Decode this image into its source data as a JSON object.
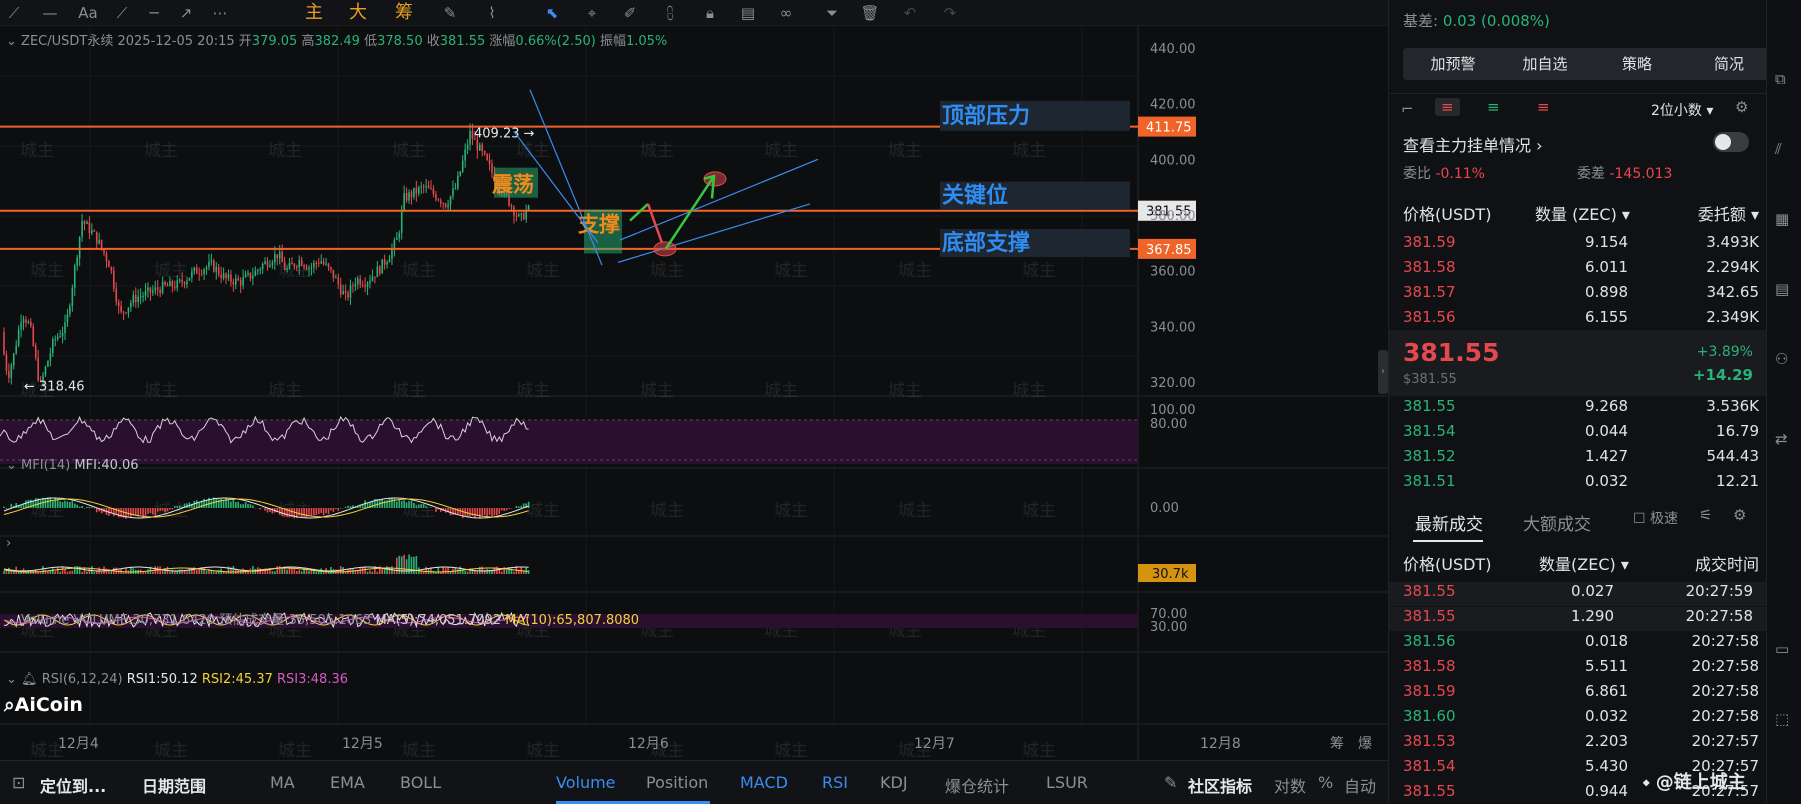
{
  "toolbar": {
    "items": [
      "主",
      "大",
      "筹"
    ]
  },
  "header": {
    "symbol": "ZEC/USDT永续",
    "datetime": "2025-12-05 20:15",
    "open_label": "开",
    "open": "379.05",
    "high_label": "高",
    "high": "382.49",
    "low_label": "低",
    "low": "378.50",
    "close_label": "收",
    "close": "381.55",
    "change_label": "涨幅",
    "change": "0.66%(2.50)",
    "amp_label": "振幅",
    "amp": "1.05%"
  },
  "price_axis": {
    "ticks": [
      "440.00",
      "420.00",
      "400.00",
      "380.00",
      "360.00",
      "340.00",
      "320.00"
    ]
  },
  "levels": [
    {
      "price": "411.75",
      "color": "#f0642a"
    },
    {
      "price": "381.55",
      "color": "#f0642a"
    },
    {
      "price": "367.85",
      "color": "#f0642a"
    }
  ],
  "annotations": {
    "top": "顶部压力",
    "key": "关键位",
    "bottom": "底部支撑",
    "oscillation": "震荡",
    "support": "支撑",
    "high_marker": "409.23 →",
    "low_marker": "← 318.46"
  },
  "indicators": {
    "mfi": {
      "label": "MFI(14)",
      "value": "MFI:40.06",
      "ticks": [
        "100.00",
        "80.00"
      ]
    },
    "macd": {
      "tick": "0.00"
    },
    "volume": {
      "label": "Volume",
      "value": "VOLUME:30,731.6420",
      "est": "预估成交量:35,505.1063",
      "ma5": "MA(5):74,051.7092",
      "ma10": "MA(10):65,807.8080",
      "last": "30.7k"
    },
    "rsi": {
      "label": "RSI(6,12,24)",
      "rsi1": "RSI1:50.12",
      "rsi2": "RSI2:45.37",
      "rsi3": "RSI3:48.36",
      "ticks": [
        "70.00",
        "30.00"
      ]
    }
  },
  "date_axis": [
    "12月4",
    "12月5",
    "12月6",
    "12月7",
    "12月8"
  ],
  "date_axis_right": [
    "筹",
    "爆"
  ],
  "watermark": "城主",
  "logo": "AiCoin",
  "bottom": {
    "locate": "定位到...",
    "date_range": "日期范围",
    "tabs1": [
      "MA",
      "EMA",
      "BOLL"
    ],
    "tabs2": [
      "Volume",
      "Position",
      "MACD",
      "RSI",
      "KDJ",
      "爆仓统计",
      "LSUR"
    ],
    "indicators": "社区指标",
    "log": "对数",
    "pct": "%",
    "auto": "自动"
  },
  "right": {
    "basis_label": "基差",
    "basis": "0.03 (0.008%)",
    "buttons": [
      "加预警",
      "加自选",
      "策略",
      "简况"
    ],
    "decimals": "2位小数",
    "main_orders": "查看主力挂单情况",
    "ratio_label": "委比",
    "ratio": "-0.11%",
    "diff_label": "委差",
    "diff": "-145.013",
    "book_header": [
      "价格(USDT)",
      "数量 (ZEC)",
      "委托额"
    ],
    "asks": [
      [
        "381.59",
        "9.154",
        "3.493K"
      ],
      [
        "381.58",
        "6.011",
        "2.294K"
      ],
      [
        "381.57",
        "0.898",
        "342.65"
      ],
      [
        "381.56",
        "6.155",
        "2.349K"
      ]
    ],
    "last_price": "381.55",
    "last_usd": "$381.55",
    "pct": "+3.89%",
    "chg": "+14.29",
    "bids": [
      [
        "381.55",
        "9.268",
        "3.536K"
      ],
      [
        "381.54",
        "0.044",
        "16.79"
      ],
      [
        "381.52",
        "1.427",
        "544.43"
      ],
      [
        "381.51",
        "0.032",
        "12.21"
      ]
    ],
    "trade_tabs": [
      "最新成交",
      "大额成交"
    ],
    "fast": "极速",
    "trade_header": [
      "价格(USDT)",
      "数量(ZEC)",
      "成交时间"
    ],
    "trades": [
      [
        "381.55",
        "0.027",
        "20:27:59",
        "r"
      ],
      [
        "381.55",
        "1.290",
        "20:27:58",
        "r"
      ],
      [
        "381.56",
        "0.018",
        "20:27:58",
        "g"
      ],
      [
        "381.58",
        "5.511",
        "20:27:58",
        "r"
      ],
      [
        "381.59",
        "6.861",
        "20:27:58",
        "r"
      ],
      [
        "381.60",
        "0.032",
        "20:27:58",
        "g"
      ],
      [
        "381.53",
        "2.203",
        "20:27:57",
        "r"
      ],
      [
        "381.54",
        "5.430",
        "20:27:57",
        "r"
      ],
      [
        "381.55",
        "0.944",
        "20:27:57",
        "r"
      ]
    ],
    "footer": "@链上城主"
  },
  "chart_data": {
    "type": "candlestick",
    "title": "ZEC/USDT永续",
    "ylim": [
      310,
      445
    ],
    "x_labels": [
      "12月4",
      "12月5",
      "12月6",
      "12月7",
      "12月8"
    ],
    "price_levels": [
      411.75,
      381.55,
      367.85
    ],
    "marked_high": 409.23,
    "marked_low": 318.46,
    "last": 381.55
  }
}
